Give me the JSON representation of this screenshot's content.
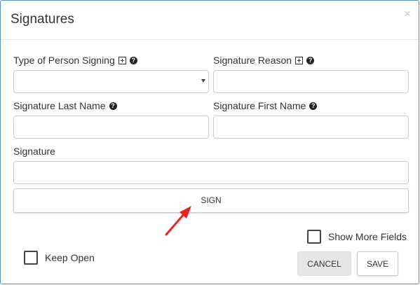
{
  "dialog": {
    "title": "Signatures",
    "close_symbol": "×"
  },
  "fields": {
    "type_of_person": {
      "label": "Type of Person Signing",
      "value": ""
    },
    "signature_reason": {
      "label": "Signature Reason",
      "value": ""
    },
    "last_name": {
      "label": "Signature Last Name",
      "value": ""
    },
    "first_name": {
      "label": "Signature First Name",
      "value": ""
    },
    "signature": {
      "label": "Signature",
      "value": ""
    }
  },
  "buttons": {
    "sign": "SIGN",
    "cancel": "CANCEL",
    "save": "SAVE"
  },
  "options": {
    "show_more_fields": {
      "label": "Show More Fields",
      "checked": false
    },
    "keep_open": {
      "label": "Keep Open",
      "checked": false
    }
  },
  "icons": {
    "help": "?",
    "annotation_arrow_color": "#e8231d"
  }
}
